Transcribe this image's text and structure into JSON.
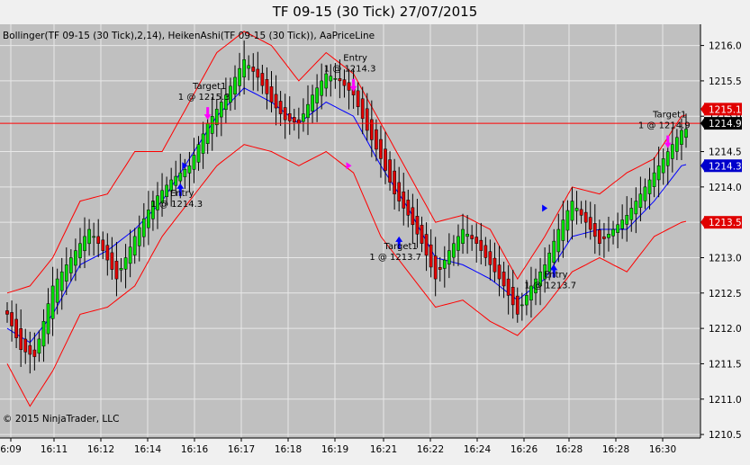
{
  "window": {
    "title": "TF 09-15 (30 Tick)  27/07/2015"
  },
  "indicator_label": "Bollinger(TF 09-15 (30 Tick),2,14), HeikenAshi(TF 09-15 (30 Tick)), AaPriceLine",
  "copyright": "© 2015 NinjaTrader, LLC",
  "colors": {
    "plot_bg": "#c0c0c0",
    "up_candle": "#00e000",
    "down_candle": "#e00000",
    "bollinger_band": "#ff0000",
    "bollinger_mid": "#0000ff",
    "price_line": "#ff0000",
    "arrow_entry": "#0000ff",
    "arrow_target": "#ff00ff"
  },
  "chart_data": {
    "type": "candlestick",
    "title": "TF 09-15 (30 Tick)  27/07/2015",
    "y_range": [
      1210.45,
      1216.3
    ],
    "y_ticks": [
      "1210.5",
      "1211.0",
      "1211.5",
      "1212.0",
      "1212.5",
      "1213.0",
      "1213.5",
      "1214.0",
      "1214.5",
      "1215.0",
      "1215.5",
      "1216.0"
    ],
    "x_ticks": [
      "6:09",
      "16:11",
      "16:12",
      "16:14",
      "16:16",
      "16:17",
      "16:18",
      "16:19",
      "16:21",
      "16:22",
      "16:24",
      "16:26",
      "16:28",
      "16:28",
      "16:30"
    ],
    "close_anchors": [
      [
        0,
        1212.2
      ],
      [
        3,
        1211.7
      ],
      [
        6,
        1211.6
      ],
      [
        10,
        1212.6
      ],
      [
        14,
        1213.0
      ],
      [
        18,
        1213.4
      ],
      [
        21,
        1213.1
      ],
      [
        24,
        1212.7
      ],
      [
        28,
        1213.3
      ],
      [
        32,
        1213.8
      ],
      [
        36,
        1214.1
      ],
      [
        40,
        1214.3
      ],
      [
        44,
        1214.9
      ],
      [
        48,
        1215.3
      ],
      [
        52,
        1215.8
      ],
      [
        55,
        1215.55
      ],
      [
        58,
        1215.2
      ],
      [
        61,
        1214.95
      ],
      [
        64,
        1214.9
      ],
      [
        67,
        1215.3
      ],
      [
        70,
        1215.6
      ],
      [
        73,
        1215.5
      ],
      [
        76,
        1215.3
      ],
      [
        79,
        1214.8
      ],
      [
        82,
        1214.4
      ],
      [
        85,
        1213.9
      ],
      [
        88,
        1213.6
      ],
      [
        91,
        1213.2
      ],
      [
        94,
        1212.7
      ],
      [
        97,
        1213.1
      ],
      [
        100,
        1213.4
      ],
      [
        103,
        1213.2
      ],
      [
        106,
        1212.9
      ],
      [
        109,
        1212.6
      ],
      [
        112,
        1212.2
      ],
      [
        115,
        1212.6
      ],
      [
        118,
        1212.9
      ],
      [
        121,
        1213.4
      ],
      [
        124,
        1213.8
      ],
      [
        127,
        1213.5
      ],
      [
        130,
        1213.2
      ],
      [
        133,
        1213.4
      ],
      [
        136,
        1213.6
      ],
      [
        139,
        1213.9
      ],
      [
        142,
        1214.2
      ],
      [
        145,
        1214.5
      ],
      [
        148,
        1214.8
      ]
    ],
    "bollinger": {
      "upper_anchors": [
        [
          0,
          1212.5
        ],
        [
          5,
          1212.6
        ],
        [
          10,
          1213.0
        ],
        [
          16,
          1213.8
        ],
        [
          22,
          1213.9
        ],
        [
          28,
          1214.5
        ],
        [
          34,
          1214.5
        ],
        [
          40,
          1215.2
        ],
        [
          46,
          1215.9
        ],
        [
          52,
          1216.2
        ],
        [
          58,
          1216.0
        ],
        [
          64,
          1215.5
        ],
        [
          70,
          1215.9
        ],
        [
          76,
          1215.6
        ],
        [
          82,
          1214.9
        ],
        [
          88,
          1214.2
        ],
        [
          94,
          1213.5
        ],
        [
          100,
          1213.6
        ],
        [
          106,
          1213.4
        ],
        [
          112,
          1212.7
        ],
        [
          118,
          1213.3
        ],
        [
          124,
          1214.0
        ],
        [
          130,
          1213.9
        ],
        [
          136,
          1214.2
        ],
        [
          142,
          1214.4
        ],
        [
          148,
          1215.0
        ]
      ],
      "lower_anchors": [
        [
          0,
          1211.5
        ],
        [
          5,
          1210.9
        ],
        [
          10,
          1211.4
        ],
        [
          16,
          1212.2
        ],
        [
          22,
          1212.3
        ],
        [
          28,
          1212.6
        ],
        [
          34,
          1213.3
        ],
        [
          40,
          1213.8
        ],
        [
          46,
          1214.3
        ],
        [
          52,
          1214.6
        ],
        [
          58,
          1214.5
        ],
        [
          64,
          1214.3
        ],
        [
          70,
          1214.5
        ],
        [
          76,
          1214.2
        ],
        [
          82,
          1213.3
        ],
        [
          88,
          1212.8
        ],
        [
          94,
          1212.3
        ],
        [
          100,
          1212.4
        ],
        [
          106,
          1212.1
        ],
        [
          112,
          1211.9
        ],
        [
          118,
          1212.3
        ],
        [
          124,
          1212.8
        ],
        [
          130,
          1213.0
        ],
        [
          136,
          1212.8
        ],
        [
          142,
          1213.3
        ],
        [
          148,
          1213.5
        ]
      ],
      "mid_anchors": [
        [
          0,
          1212.0
        ],
        [
          5,
          1211.8
        ],
        [
          10,
          1212.2
        ],
        [
          16,
          1212.9
        ],
        [
          22,
          1213.1
        ],
        [
          28,
          1213.4
        ],
        [
          34,
          1213.8
        ],
        [
          40,
          1214.4
        ],
        [
          46,
          1215.0
        ],
        [
          52,
          1215.4
        ],
        [
          58,
          1215.2
        ],
        [
          64,
          1214.9
        ],
        [
          70,
          1215.2
        ],
        [
          76,
          1215.0
        ],
        [
          82,
          1214.3
        ],
        [
          88,
          1213.7
        ],
        [
          94,
          1213.0
        ],
        [
          100,
          1212.9
        ],
        [
          106,
          1212.7
        ],
        [
          112,
          1212.4
        ],
        [
          118,
          1212.7
        ],
        [
          124,
          1213.3
        ],
        [
          130,
          1213.4
        ],
        [
          136,
          1213.4
        ],
        [
          142,
          1213.8
        ],
        [
          148,
          1214.3
        ]
      ]
    },
    "price_line": 1214.9,
    "axis_markers": [
      {
        "label": "1215.1",
        "value": 1215.1,
        "bg": "#e00000",
        "fg": "#ffffff"
      },
      {
        "label": "1214.9",
        "value": 1214.9,
        "bg": "#000000",
        "fg": "#ffffff"
      },
      {
        "label": "1214.3",
        "value": 1214.3,
        "bg": "#0000cc",
        "fg": "#ffffff"
      },
      {
        "label": "1213.5",
        "value": 1213.5,
        "bg": "#e00000",
        "fg": "#ffffff"
      }
    ],
    "annotations": [
      {
        "bar": 44,
        "value": 1214.95,
        "line1": "Target1",
        "line2": "1 @ 1215.3",
        "color": "#ff00ff",
        "dir": "down"
      },
      {
        "bar": 38,
        "value": 1214.05,
        "line1": "Entry",
        "line2": "1 @ 1214.3",
        "color": "#0000ff",
        "dir": "up"
      },
      {
        "bar": 76,
        "value": 1215.35,
        "line1": "Entry",
        "line2": "1 @ 1214.3",
        "color": "#ff00ff",
        "dir": "down"
      },
      {
        "bar": 86,
        "value": 1213.3,
        "line1": "Target1",
        "line2": "1 @ 1213.7",
        "color": "#0000ff",
        "dir": "up"
      },
      {
        "bar": 120,
        "value": 1212.9,
        "line1": "Entry",
        "line2": "1 @ 1213.7",
        "color": "#0000ff",
        "dir": "up"
      },
      {
        "bar": 145,
        "value": 1214.55,
        "line1": "Target1",
        "line2": "1 @ 1214.9",
        "color": "#ff00ff",
        "dir": "down"
      }
    ],
    "small_triangles": [
      {
        "bar": 39,
        "value": 1214.3,
        "color": "#0000ff"
      },
      {
        "bar": 75,
        "value": 1214.3,
        "color": "#ff00ff"
      },
      {
        "bar": 118,
        "value": 1213.7,
        "color": "#0000ff"
      }
    ],
    "bar_count": 150
  }
}
